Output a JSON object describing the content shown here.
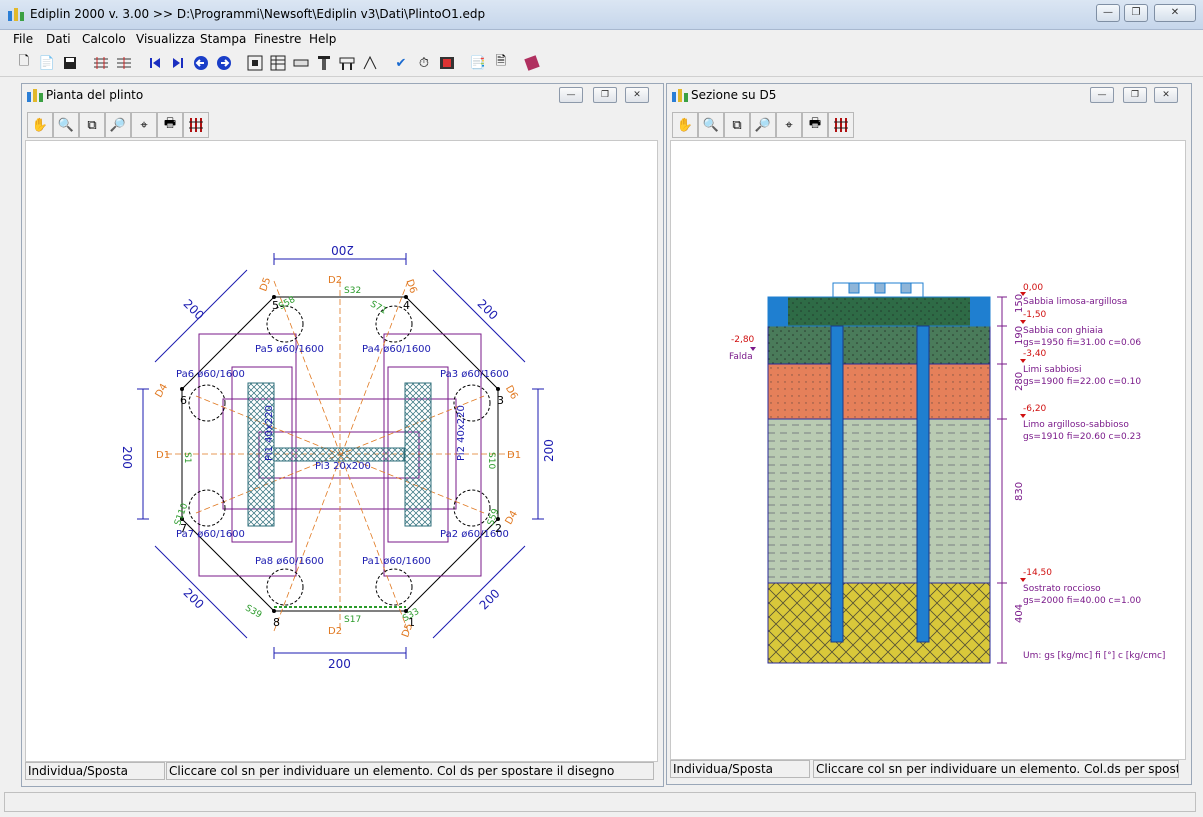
{
  "app": {
    "title": "Ediplin 2000 v. 3.00 >> D:\\Programmi\\Newsoft\\Ediplin v3\\Dati\\PlintoO1.edp"
  },
  "menu": [
    "File",
    "Dati",
    "Calcolo",
    "Visualizza",
    "Stampa",
    "Finestre",
    "Help"
  ],
  "toolbar_icons": [
    "new-icon",
    "open-icon",
    "save-icon",
    "grid-icon",
    "grid-edit-icon",
    "first-icon",
    "last-icon",
    "prev-icon",
    "next-icon",
    "fit-icon",
    "table-icon",
    "beam-icon",
    "pile-icon",
    "cap-icon",
    "rebar-icon",
    "check-icon",
    "timer-icon",
    "film-icon",
    "copy-icon",
    "report-icon",
    "book-icon"
  ],
  "plan": {
    "title": "Pianta del plinto",
    "status_mode": "Individua/Sposta",
    "status_msg": "Cliccare col sn per individuare un elemento. Col ds per spostare il disegno",
    "dim_top": "200",
    "dim_bottom": "200",
    "dim_left": "200",
    "dim_right": "200",
    "dim_tl": "200",
    "dim_tr": "200",
    "dim_bl": "200",
    "dim_br": "200",
    "piles": [
      {
        "label": "Pa1 ø60/1600",
        "num": "1"
      },
      {
        "label": "Pa2 ø60/1600",
        "num": "2"
      },
      {
        "label": "Pa3 ø60/1600",
        "num": "3"
      },
      {
        "label": "Pa4 ø60/1600",
        "num": "4"
      },
      {
        "label": "Pa5 ø60/1600",
        "num": "5"
      },
      {
        "label": "Pa6 ø60/1600",
        "num": "6"
      },
      {
        "label": "Pa7 ø60/1600",
        "num": "7"
      },
      {
        "label": "Pa8 ø60/1600",
        "num": "8"
      }
    ],
    "pillars": {
      "left": "Pi1 40x220",
      "right": "Pi2 40x220",
      "center": "Pi3 20x200"
    },
    "axes": [
      "D1",
      "D1",
      "D2",
      "D2",
      "D4",
      "D4",
      "D5",
      "D5",
      "D6",
      "D6"
    ],
    "sections": [
      "S32",
      "S17",
      "S1",
      "S10",
      "S58",
      "S71",
      "S39",
      "S110",
      "S59",
      "S33"
    ]
  },
  "section": {
    "title": "Sezione su D5",
    "status_mode": "Individua/Sposta",
    "status_msg": "Cliccare col sn per individuare un elemento. Col.ds per spostare il disegno",
    "falda": {
      "elev": "-2,80",
      "label": "Falda"
    },
    "levels": [
      "0,00",
      "-1,50",
      "-3,40",
      "-6,20",
      "-14,50"
    ],
    "thickness": [
      "150",
      "190",
      "280",
      "830",
      "404"
    ],
    "layers": [
      {
        "name": "Sabbia limosa-argillosa",
        "props": ""
      },
      {
        "name": "Sabbia con ghiaia",
        "props": "gs=1950  fi=31.00  c=0.06"
      },
      {
        "name": "Limi sabbiosi",
        "props": "gs=1900  fi=22.00  c=0.10"
      },
      {
        "name": "Limo argilloso-sabbioso",
        "props": "gs=1910  fi=20.60  c=0.23"
      },
      {
        "name": "Sostrato roccioso",
        "props": "gs=2000  fi=40.00  c=1.00"
      }
    ],
    "units": "Um: gs [kg/mc]  fi [°]  c [kg/cmc]"
  },
  "colors": {
    "dim": "#1b1bb0",
    "axis": "#e07820",
    "outline": "#7a1a8a",
    "pile": "#1f7fd0",
    "green_text": "#2a9a2a",
    "layer1": "#2e6b46",
    "layer3": "#e5805a",
    "layer4": "#b9cbb2",
    "layer5": "#d9c83a"
  }
}
